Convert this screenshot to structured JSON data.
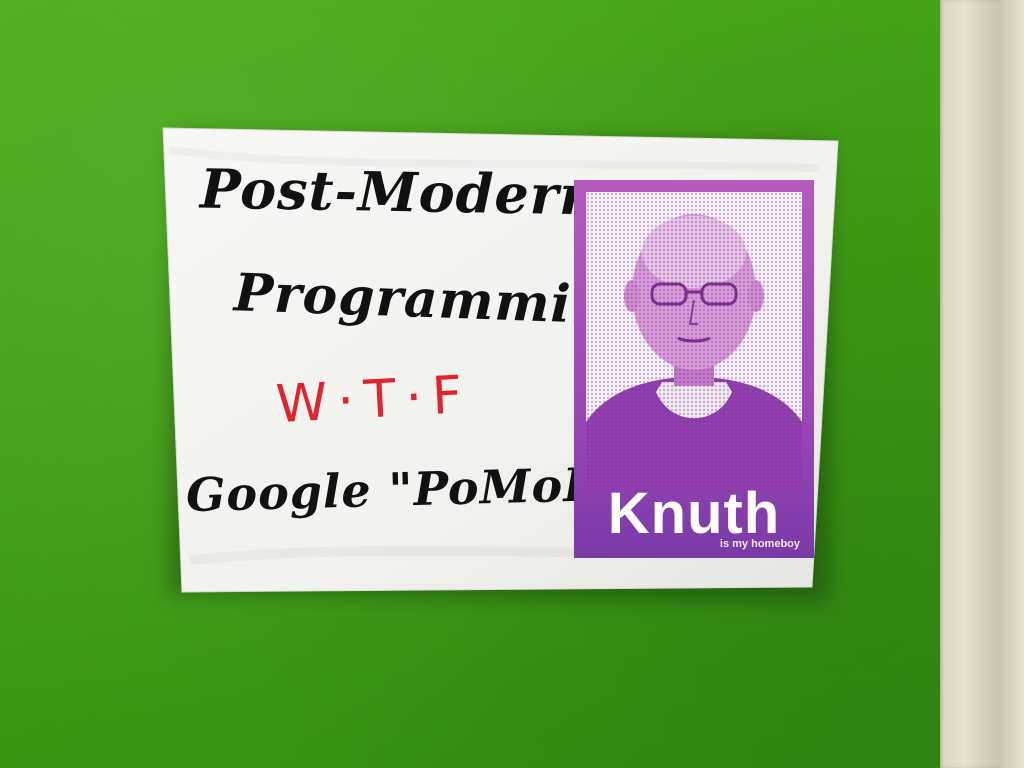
{
  "note": {
    "line1": "Post-Modern",
    "line2": "Programming?",
    "line3": "W·T·F",
    "line4": "Google \"PoMoPo\""
  },
  "poster": {
    "title": "Knuth",
    "subtitle": "is my homeboy",
    "colors": {
      "frame": "#9b48b5",
      "title_text": "#ffffff"
    }
  },
  "colors": {
    "wall": "#43a116",
    "paper": "#f5f5f3",
    "ink_black": "#111111",
    "ink_red": "#e0242c",
    "door_frame": "#dcd7c5"
  }
}
